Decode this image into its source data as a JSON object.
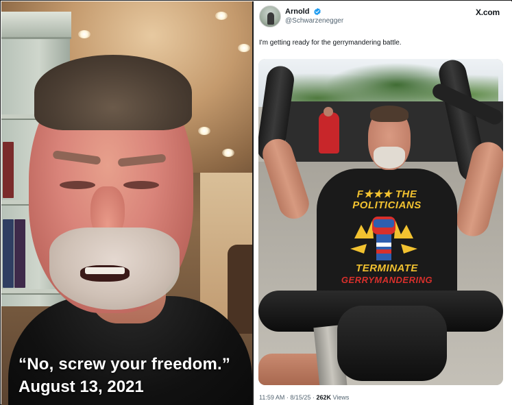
{
  "left_panel": {
    "caption_quote": "“No, screw your freedom.”",
    "caption_date": "August 13, 2021"
  },
  "post": {
    "display_name": "Arnold",
    "handle": "@Schwarzenegger",
    "source": "X.com",
    "text": "I'm getting ready for the gerrymandering battle.",
    "shirt_text": {
      "line1": "F★★★ THE",
      "line2": "POLITICIANS",
      "line3": "TERMINATE",
      "line4": "GERRYMANDERING"
    },
    "time": "11:59 AM",
    "date": "8/15/25",
    "views_count": "262K",
    "views_label": "Views",
    "separator": "·"
  },
  "colors": {
    "verified_badge": "#1d9bf0",
    "shirt_yellow": "#f2c230",
    "shirt_red": "#d8302c",
    "meta_gray": "#536471"
  },
  "icons": {
    "verified": "verified-badge-icon"
  }
}
